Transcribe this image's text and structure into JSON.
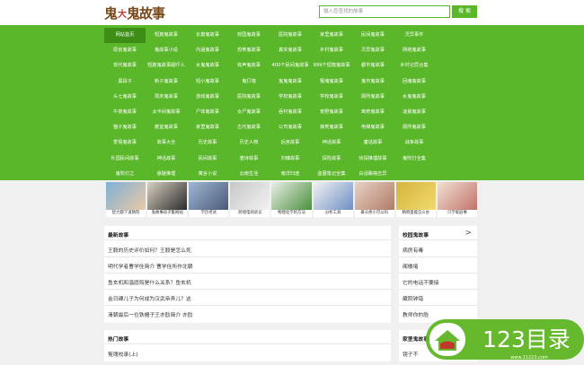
{
  "logo": {
    "text1": "鬼",
    "text2": "大",
    "text3": "故事"
  },
  "search": {
    "placeholder": "输入您查找的故事",
    "button": "搜 索"
  },
  "nav": [
    "网站首页",
    "短篇鬼故事",
    "长篇鬼故事",
    "校园鬼故事",
    "医院鬼故事",
    "家里鬼故事",
    "民间鬼故事",
    "灵异事件",
    "",
    "原创鬼故事",
    "鬼故事小说",
    "内涵鬼故事",
    "恐怖鬼故事",
    "真实鬼故事",
    "乡村鬼故事",
    "灵异鬼故事",
    "网络鬼故事",
    "",
    "现代鬼故事",
    "短篇鬼故事超吓人",
    "女鬼鬼故事",
    "有声鬼故事",
    "400个民间鬼故事",
    "999个短篇鬼故事",
    "都市鬼故事",
    "乡村记异合集",
    "",
    "黑段子",
    "新子鬼故事",
    "短小鬼故事",
    "鬼打墙",
    "鬼鬼鬼故事",
    "冤魂鬼故事",
    "鬼市鬼故事",
    "回魂鬼故事",
    "",
    "头七鬼故事",
    "周末鬼故事",
    "游戏鬼故事",
    "医院鬼故事",
    "学校鬼故事",
    "学校鬼故事",
    "厕所鬼故事",
    "水鬼鬼故事",
    "",
    "午夜鬼故事",
    "太平间鬼故事",
    "尸体鬼故事",
    "女尸鬼故事",
    "吞村鬼故事",
    "荒野鬼故事",
    "离奇鬼故事",
    "凌晨鬼故事",
    "",
    "猫子鬼故事",
    "教室鬼故事",
    "家里鬼故事",
    "古代鬼故事",
    "公司鬼故事",
    "搞笑鬼故事",
    "电梯鬼故事",
    "厕所鬼故事",
    "",
    "爱情鬼故事",
    "故事大全",
    "历史故事",
    "历史人物",
    "后宫故事",
    "神话故事",
    "童话故事",
    "战争故事",
    "",
    "外国民间故事",
    "神话故事",
    "民间故事",
    "唐诗故事",
    "刘墉故事",
    "探险故事",
    "侦探推理故事",
    "鬼吹灯全集",
    "",
    "鬼吹灯之",
    "悬疑推理",
    "寓言小说",
    "云南生活",
    "南洋归途",
    "盗墓笔记全集",
    "白话聊斋志异",
    "",
    ""
  ],
  "thumbs": [
    {
      "caption": "智力题下道猜院"
    },
    {
      "caption": "鬼故事段子集网站"
    },
    {
      "caption": "学历考试"
    },
    {
      "caption": "跨境电商诉讼"
    },
    {
      "caption": "物理化学的方法"
    },
    {
      "caption": "分析工具"
    },
    {
      "caption": "鼻头修小可以吗"
    },
    {
      "caption": "鹌鹑蛋能怎么办"
    },
    {
      "caption": "只学家庭事"
    }
  ],
  "latest": {
    "title": "最新故事",
    "items": [
      "王毅的历史评价如何？王毅是怎么死",
      "明代学者曹学佺简介 曹学佺所作北朝",
      "鱼玄机和温庭筠是什么关系？鱼玄机",
      "金日磾儿子为何成为汉武帝弄儿？这",
      "清朝最后一位铁帽子王亦劻简介 亦劻"
    ]
  },
  "hot": {
    "title": "热门故事",
    "items": [
      "冤魂校录(上)"
    ]
  },
  "campus": {
    "title": "校园鬼故事",
    "arrow": ">",
    "items": [
      "病房有毒",
      "阁楼堵",
      "它的电话不要接",
      "藏阴钟错",
      "教师你的脸"
    ]
  },
  "home": {
    "title": "家里鬼故事",
    "items": [
      "镜子不"
    ]
  },
  "watermark": {
    "text": "123目录",
    "url": "www.11223.com"
  }
}
